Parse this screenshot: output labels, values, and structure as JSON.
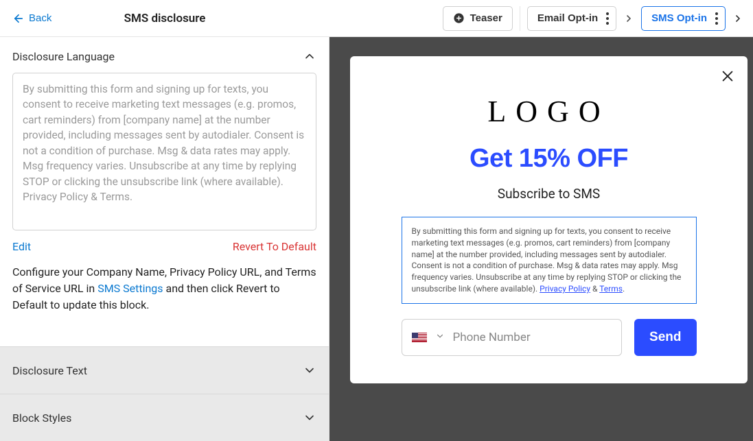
{
  "top": {
    "back_label": "Back",
    "title": "SMS disclosure",
    "steps": {
      "teaser": "Teaser",
      "email": "Email Opt-in",
      "sms": "SMS Opt-in"
    }
  },
  "panel": {
    "section_title": "Disclosure Language",
    "textarea_value": "By submitting this form and signing up for texts, you consent to receive marketing text messages (e.g. promos, cart reminders) from [company name] at the number provided, including messages sent by autodialer. Consent is not a condition of purchase. Msg & data rates may apply. Msg frequency varies. Unsubscribe at any time by replying STOP or clicking the unsubscribe link (where available). Privacy Policy & Terms.",
    "edit_label": "Edit",
    "revert_label": "Revert To Default",
    "config_text_1": "Configure your Company Name, Privacy Policy URL, and Terms of Service URL in ",
    "config_link": "SMS Settings",
    "config_text_2": " and then click Revert to Default to update this block.",
    "collapsed": {
      "disclosure_text": "Disclosure Text",
      "block_styles": "Block Styles"
    }
  },
  "preview": {
    "logo": "LOGO",
    "headline": "Get 15% OFF",
    "subhead": "Subscribe to SMS",
    "disclosure_main": "By submitting this form and signing up for texts, you consent to receive marketing text messages (e.g. promos, cart reminders) from [company name] at the number provided, including messages sent by autodialer. Consent is not a condition of purchase. Msg & data rates may apply. Msg frequency varies. Unsubscribe at any time by replying STOP or clicking the unsubscribe link (where available). ",
    "privacy_link": "Privacy Policy",
    "amp": " & ",
    "terms_link": "Terms",
    "period": ".",
    "phone_placeholder": "Phone Number",
    "send_label": "Send"
  }
}
